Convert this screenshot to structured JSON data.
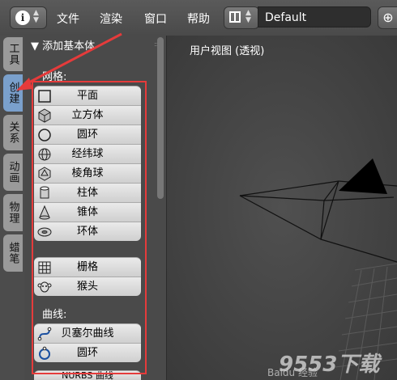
{
  "menubar": {
    "items": [
      "文件",
      "渲染",
      "窗口",
      "帮助"
    ],
    "layout_name": "Default"
  },
  "tabs": [
    "工具",
    "创建",
    "关系",
    "动画",
    "物理",
    "蜡笔"
  ],
  "panel": {
    "header": "▼ 添加基本体",
    "mesh_label": "网格:",
    "mesh_items": [
      "平面",
      "立方体",
      "圆环",
      "经纬球",
      "棱角球",
      "柱体",
      "锥体",
      "环体"
    ],
    "grid_items": [
      "栅格",
      "猴头"
    ],
    "curve_label": "曲线:",
    "curve_items": [
      "贝塞尔曲线",
      "圆环"
    ],
    "partial_item": "NURBS 曲线"
  },
  "viewport": {
    "label": "用户视图 (透视)"
  },
  "watermark": {
    "text": "9553下载",
    "sub": "Baidu 经验"
  },
  "colors": {
    "highlight": "#e53b3b",
    "active_tab": "#7aa0cc"
  }
}
